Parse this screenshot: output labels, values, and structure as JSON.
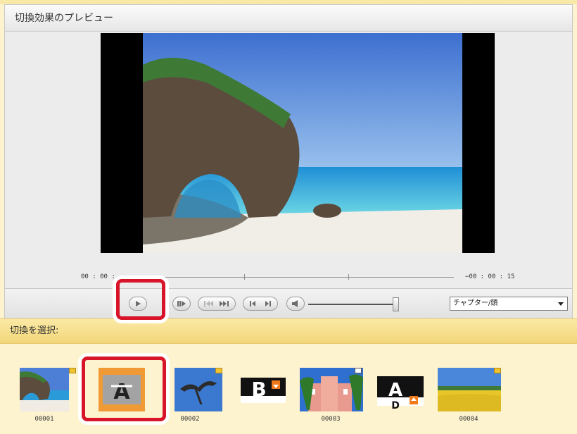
{
  "preview_panel": {
    "title": "切換効果のプレビュー",
    "time_start": "00 : 00 :",
    "time_end": "−00 : 00 : 15"
  },
  "controls": {
    "icons": [
      "play-icon",
      "step-play-icon",
      "prev-next-skip-icon",
      "first-last-icon",
      "volume-icon"
    ],
    "chapter_select": {
      "selected": "チャプター/頭"
    }
  },
  "transition_section": {
    "title": "切換を選択:"
  },
  "thumbnails": [
    {
      "type": "clip",
      "label": "00001"
    },
    {
      "type": "transition",
      "label": ""
    },
    {
      "type": "clip",
      "label": "00002"
    },
    {
      "type": "transition",
      "label": ""
    },
    {
      "type": "clip",
      "label": "00003"
    },
    {
      "type": "transition",
      "label": ""
    },
    {
      "type": "clip",
      "label": "00004"
    }
  ],
  "colors": {
    "highlight": "#d8142a",
    "section_bar": "#f2d67a",
    "background": "#fdf3cf"
  }
}
